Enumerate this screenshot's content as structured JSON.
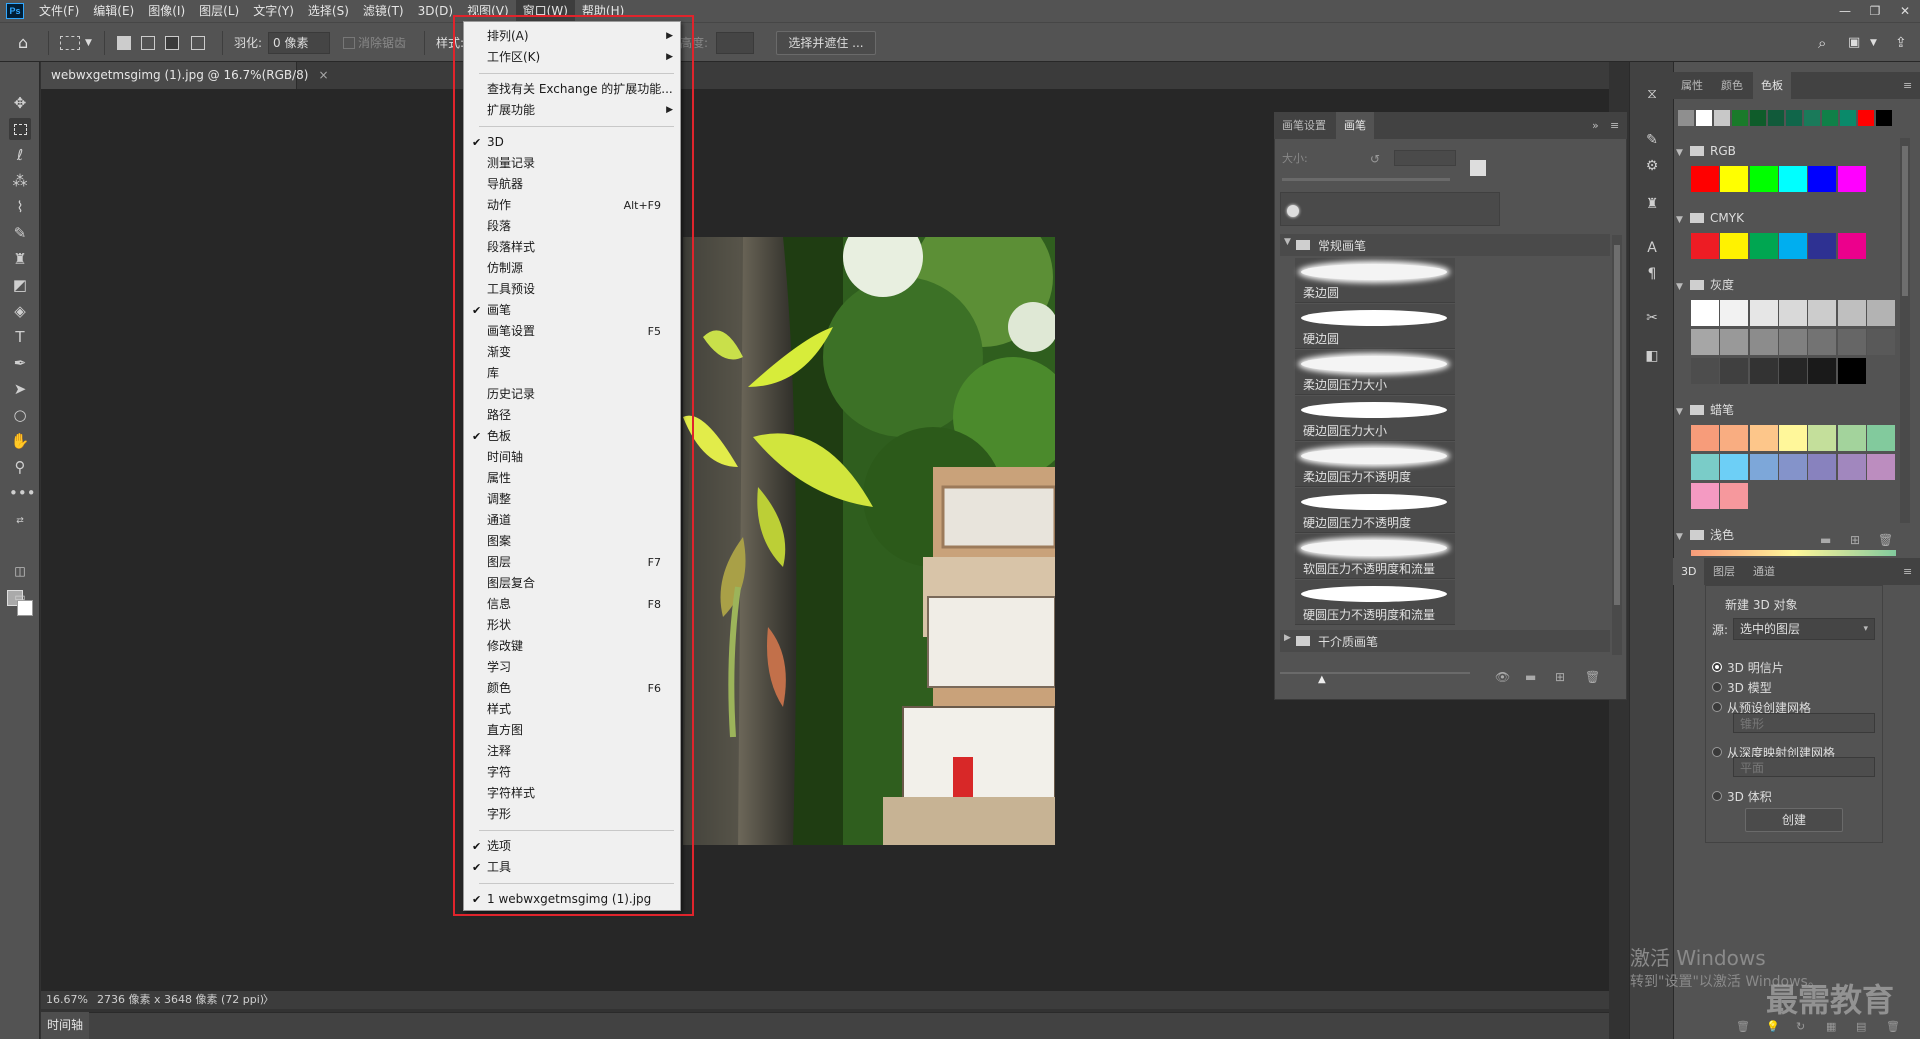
{
  "app": {
    "logo": "Ps"
  },
  "menubar": {
    "items": [
      "文件(F)",
      "编辑(E)",
      "图像(I)",
      "图层(L)",
      "文字(Y)",
      "选择(S)",
      "滤镜(T)",
      "3D(D)",
      "视图(V)",
      "窗口(W)",
      "帮助(H)"
    ],
    "active_index": 9
  },
  "window_controls": {
    "minimize": "—",
    "restore": "❐",
    "close": "✕"
  },
  "options": {
    "feather_label": "羽化:",
    "feather_value": "0 像素",
    "antialias_label": "消除锯齿",
    "style_label": "样式:",
    "height_label": "高度:",
    "select_mask": "选择并遮住 ..."
  },
  "document": {
    "tab_title": "webwxgetmsgimg (1).jpg @ 16.7%(RGB/8)",
    "tab_close": "×",
    "zoom": "16.67%",
    "info": "2736 像素 x 3648 像素 (72 ppi)",
    "info_arrow": "〉"
  },
  "timeline": {
    "tab": "时间轴"
  },
  "window_menu": {
    "items": [
      {
        "label": "排列(A)",
        "submenu": true
      },
      {
        "label": "工作区(K)",
        "submenu": true
      },
      {
        "sep": true
      },
      {
        "label": "查找有关 Exchange 的扩展功能..."
      },
      {
        "label": "扩展功能",
        "submenu": true
      },
      {
        "sep": true
      },
      {
        "label": "3D",
        "checked": true
      },
      {
        "label": "测量记录"
      },
      {
        "label": "导航器"
      },
      {
        "label": "动作",
        "shortcut": "Alt+F9"
      },
      {
        "label": "段落"
      },
      {
        "label": "段落样式"
      },
      {
        "label": "仿制源"
      },
      {
        "label": "工具预设"
      },
      {
        "label": "画笔",
        "checked": true
      },
      {
        "label": "画笔设置",
        "shortcut": "F5"
      },
      {
        "label": "渐变"
      },
      {
        "label": "库"
      },
      {
        "label": "历史记录"
      },
      {
        "label": "路径"
      },
      {
        "label": "色板",
        "checked": true
      },
      {
        "label": "时间轴"
      },
      {
        "label": "属性"
      },
      {
        "label": "调整"
      },
      {
        "label": "通道"
      },
      {
        "label": "图案"
      },
      {
        "label": "图层",
        "shortcut": "F7"
      },
      {
        "label": "图层复合"
      },
      {
        "label": "信息",
        "shortcut": "F8"
      },
      {
        "label": "形状"
      },
      {
        "label": "修改键"
      },
      {
        "label": "学习"
      },
      {
        "label": "颜色",
        "shortcut": "F6"
      },
      {
        "label": "样式"
      },
      {
        "label": "直方图"
      },
      {
        "label": "注释"
      },
      {
        "label": "字符"
      },
      {
        "label": "字符样式"
      },
      {
        "label": "字形"
      },
      {
        "sep": true
      },
      {
        "label": "选项",
        "checked": true
      },
      {
        "label": "工具",
        "checked": true
      },
      {
        "sep": true
      },
      {
        "label": "1 webwxgetmsgimg (1).jpg",
        "checked": true
      }
    ]
  },
  "brush_panel": {
    "tabs": [
      "画笔设置",
      "画笔"
    ],
    "active_tab": 1,
    "size_label": "大小:",
    "collapse": "»",
    "groups": {
      "general": "常规画笔",
      "dry": "干介质画笔"
    },
    "brushes": [
      "柔边圆",
      "硬边圆",
      "柔边圆压力大小",
      "硬边圆压力大小",
      "柔边圆压力不透明度",
      "硬边圆压力不透明度",
      "软圆压力不透明度和流量",
      "硬圆压力不透明度和流量"
    ]
  },
  "swatches_panel": {
    "tabs": [
      "属性",
      "颜色",
      "色板"
    ],
    "active_tab": 2,
    "recent": [
      "#8f8f8f",
      "#ffffff",
      "#c8c8c8",
      "#1a7a2a",
      "#0f5c2a",
      "#115a3a",
      "#10664a",
      "#1a7a5a",
      "#108048",
      "#0a8a6a",
      "#ff0000",
      "#000000"
    ],
    "groups": [
      {
        "name": "RGB",
        "colors": [
          "#ff0000",
          "#ffff00",
          "#00ff00",
          "#00ffff",
          "#0000ff",
          "#ff00ff"
        ]
      },
      {
        "name": "CMYK",
        "colors": [
          "#ed1c24",
          "#fff200",
          "#00a651",
          "#00aeef",
          "#2e3192",
          "#ec008c"
        ]
      },
      {
        "name": "灰度",
        "colors": [
          "#ffffff",
          "#f2f2f2",
          "#e6e6e6",
          "#d9d9d9",
          "#cccccc",
          "#bfbfbf",
          "#b3b3b3",
          "#a6a6a6",
          "#999999",
          "#8c8c8c",
          "#808080",
          "#737373",
          "#666666",
          "#595959",
          "#4d4d4d",
          "#404040",
          "#333333",
          "#262626",
          "#1a1a1a",
          "#000000"
        ]
      },
      {
        "name": "蜡笔",
        "colors": [
          "#f79c7a",
          "#f9ad81",
          "#fdc68a",
          "#fff79a",
          "#c4df9b",
          "#a3d39c",
          "#82ca9d",
          "#7accc8",
          "#6dcff6",
          "#7da7d9",
          "#8493ca",
          "#8882be",
          "#a187be",
          "#bc8dbf",
          "#f49ac2",
          "#f6989d"
        ]
      },
      {
        "name": "浅色"
      }
    ]
  },
  "panel_3d": {
    "tabs": [
      "3D",
      "图层",
      "通道"
    ],
    "active_tab": 0,
    "title": "新建 3D 对象",
    "source_label": "源:",
    "source_value": "选中的图层",
    "options": [
      "3D 明信片",
      "3D 模型",
      "从预设创建网格",
      "从深度映射创建网格",
      "3D 体积"
    ],
    "selected_option": 0,
    "preset_value": "锥形",
    "depth_value": "平面",
    "create": "创建"
  },
  "watermark": {
    "activate": "激活 Windows",
    "activate_sub": "转到\"设置\"以激活 Windows。",
    "logo": "最需教育"
  }
}
